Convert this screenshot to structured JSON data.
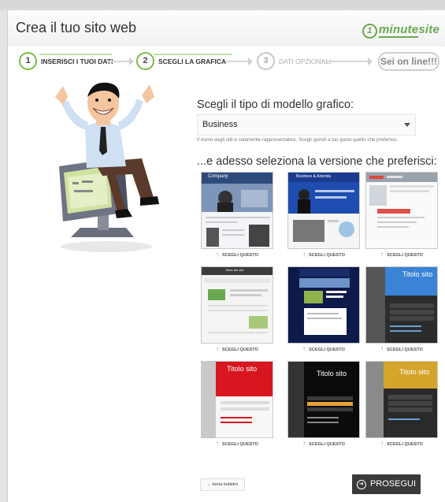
{
  "header": {
    "title": "Crea il tuo sito web",
    "logo_number": "1",
    "logo_word": "minute",
    "logo_suffix": "site"
  },
  "steps": [
    {
      "number": "1",
      "label": "INSERISCI I TUOI DATI",
      "state": "done"
    },
    {
      "number": "2",
      "label": "SCEGLI LA GRAFICA",
      "state": "active"
    },
    {
      "number": "3",
      "label": "DATI OPZIONALI",
      "state": "inactive"
    }
  ],
  "online_label": "Sei on line!!!",
  "template_type": {
    "question": "Scegli il tipo di modello grafico:",
    "selected": "Business",
    "note": "Il nome degli stili è solamente rappresentativo. Scegli quindi a tuo gusto quello che preferisci."
  },
  "version_question": "...e adesso seleziona la versione che preferisci:",
  "templates": [
    {
      "caption": "SCEGLI QUESTO",
      "title": "Company"
    },
    {
      "caption": "SCEGLI QUESTO",
      "title": "Business & Azienda"
    },
    {
      "caption": "SCEGLI QUESTO",
      "title": ""
    },
    {
      "caption": "SCEGLI QUESTO",
      "title": "Titolo del sito"
    },
    {
      "caption": "SCEGLI QUESTO",
      "title": ""
    },
    {
      "caption": "SCEGLI QUESTO",
      "title": "Titolo sito"
    },
    {
      "caption": "SCEGLI QUESTO",
      "title": "Titolo sito"
    },
    {
      "caption": "SCEGLI QUESTO",
      "title": "Titolo sito"
    },
    {
      "caption": "SCEGLI QUESTO",
      "title": "Titolo sito"
    }
  ],
  "back_label": "torna indietro",
  "next_label": "PROSEGUI",
  "colors": {
    "accent_green": "#7bbd48",
    "button_dark": "#3a3a3a"
  }
}
